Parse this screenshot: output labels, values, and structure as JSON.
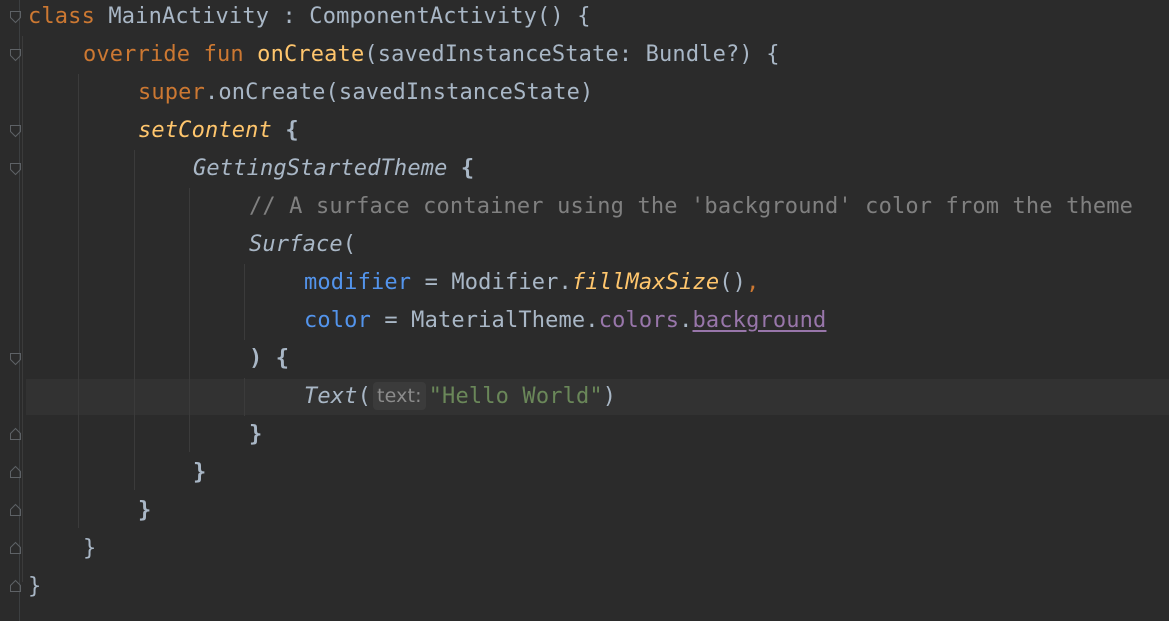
{
  "editor": {
    "language": "kotlin",
    "colors": {
      "background": "#2b2b2b",
      "keyword": "#cc7832",
      "function": "#ffc66d",
      "default": "#a9b7c6",
      "comment": "#808080",
      "named_argument": "#5394ec",
      "property": "#9876aa",
      "string": "#6a8759"
    },
    "code": {
      "l1": {
        "kw_class": "class",
        "rest": " MainActivity : ComponentActivity() {"
      },
      "l2": {
        "kw_override": "override",
        "kw_fun": "fun",
        "fn_name": "onCreate",
        "params": "(savedInstanceState: Bundle?) {"
      },
      "l3": {
        "kw_super": "super",
        "rest": ".onCreate(savedInstanceState)"
      },
      "l4": {
        "fn_name": "setContent",
        "brace": " {"
      },
      "l5": {
        "name": "GettingStartedTheme",
        "brace": " {"
      },
      "l6": {
        "comment": "// A surface container using the 'background' color from the theme"
      },
      "l7": {
        "name": "Surface",
        "paren": "("
      },
      "l8": {
        "arg": "modifier",
        "eq": " = ",
        "obj": "Modifier.",
        "fn_name": "fillMaxSize",
        "call": "()",
        "comma": ","
      },
      "l9": {
        "arg": "color",
        "eq": " = ",
        "obj": "MaterialTheme.",
        "prop_colors": "colors",
        "dot": ".",
        "prop_background": "background"
      },
      "l10": {
        "text": ") {"
      },
      "l11": {
        "name": "Text",
        "paren": "(",
        "hint": "text:",
        "string": "\"Hello World\"",
        "close": ")"
      },
      "l12": {
        "text": "}"
      },
      "l13": {
        "text": "}"
      },
      "l14": {
        "text": "}"
      },
      "l15": {
        "text": "}"
      },
      "l16": {
        "text": "}"
      }
    }
  }
}
